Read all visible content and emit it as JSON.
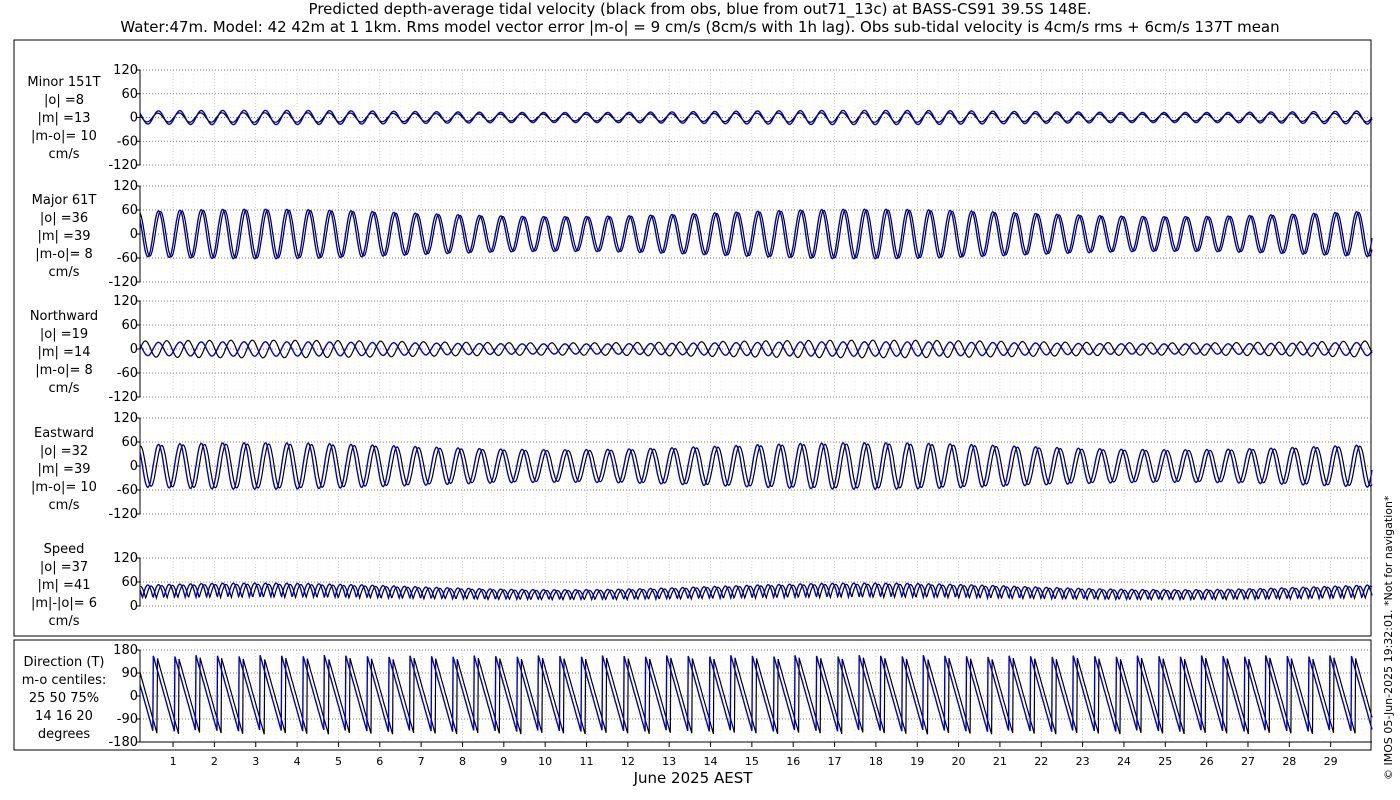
{
  "title_line1": "Predicted depth-average tidal velocity (black from obs, blue from out71_13c) at BASS-CS91 39.5S 148E.",
  "title_line2": "Water:47m. Model: 42 42m at 1 1km. Rms model vector error |m-o| = 9 cm/s (8cm/s with 1h lag). Obs sub-tidal velocity is 4cm/s rms + 6cm/s 137T mean",
  "xlabel": "June 2025 AEST",
  "copyright": "© IMOS 05-Jun-2025 19:32:01. *Not for navigation*",
  "colors": {
    "obs": "#000000",
    "model": "#0000cc",
    "grid": "#888888"
  },
  "chart_data": {
    "type": "line",
    "x_unit": "day of June 2025",
    "xlim": [
      0.2,
      30.0
    ],
    "x_ticks": [
      "1",
      "2",
      "3",
      "4",
      "5",
      "6",
      "7",
      "8",
      "9",
      "10",
      "11",
      "12",
      "13",
      "14",
      "15",
      "16",
      "17",
      "18",
      "19",
      "20",
      "21",
      "22",
      "23",
      "24",
      "25",
      "26",
      "27",
      "28",
      "29"
    ],
    "series_legend": {
      "obs": "black from obs",
      "model": "blue from out71_13c"
    },
    "panels": [
      {
        "id": "minor",
        "label_lines": [
          "Minor 151T",
          "|o| =8",
          "|m| =13",
          "|m-o|= 10",
          "cm/s"
        ],
        "ylim": [
          -120,
          120
        ],
        "yticks": [
          "120",
          "60",
          "0",
          "-60",
          "-120"
        ],
        "ytick_values": [
          120,
          60,
          0,
          -60,
          -120
        ],
        "obs_amp": 12,
        "model_amp": 18,
        "phase_lag": 0.5,
        "kind": "sin"
      },
      {
        "id": "major",
        "label_lines": [
          "Major 61T",
          "|o| =36",
          "|m| =39",
          "|m-o|= 8",
          "cm/s"
        ],
        "ylim": [
          -120,
          120
        ],
        "yticks": [
          "120",
          "60",
          "0",
          "-60",
          "-120"
        ],
        "ytick_values": [
          120,
          60,
          0,
          -60,
          -120
        ],
        "obs_amp": 60,
        "model_amp": 62,
        "phase_lag": 0.05,
        "kind": "sin"
      },
      {
        "id": "north",
        "label_lines": [
          "Northward",
          "|o| =19",
          "|m| =14",
          "|m-o|= 8",
          "cm/s"
        ],
        "ylim": [
          -120,
          120
        ],
        "yticks": [
          "120",
          "60",
          "0",
          "-60",
          "-120"
        ],
        "ytick_values": [
          120,
          60,
          0,
          -60,
          -120
        ],
        "obs_amp": 22,
        "model_amp": 18,
        "phase_lag": 0.2,
        "kind": "sin"
      },
      {
        "id": "east",
        "label_lines": [
          "Eastward",
          "|o| =32",
          "|m| =39",
          "|m-o|= 10",
          "cm/s"
        ],
        "ylim": [
          -120,
          120
        ],
        "yticks": [
          "120",
          "60",
          "0",
          "-60",
          "-120"
        ],
        "ytick_values": [
          120,
          60,
          0,
          -60,
          -120
        ],
        "obs_amp": 55,
        "model_amp": 58,
        "phase_lag": 0.08,
        "kind": "sin"
      },
      {
        "id": "speed",
        "label_lines": [
          "Speed",
          "|o| =37",
          "|m| =41",
          "|m|-|o|= 6",
          "cm/s"
        ],
        "ylim": [
          0,
          120
        ],
        "yticks": [
          "120",
          "60",
          "0"
        ],
        "ytick_values": [
          120,
          60,
          0
        ],
        "obs_amp": 55,
        "model_amp": 58,
        "phase_lag": 0.08,
        "kind": "speed"
      },
      {
        "id": "direction",
        "label_lines": [
          "Direction (T)",
          "m-o centiles:",
          "25  50  75%",
          "14  16  20",
          "degrees"
        ],
        "ylim": [
          -180,
          180
        ],
        "yticks": [
          "180",
          "90",
          "0",
          "-90",
          "-180"
        ],
        "ytick_values": [
          180,
          90,
          0,
          -90,
          -180
        ],
        "obs_amp": 180,
        "model_amp": 180,
        "phase_lag": 0.1,
        "kind": "dir"
      }
    ]
  }
}
